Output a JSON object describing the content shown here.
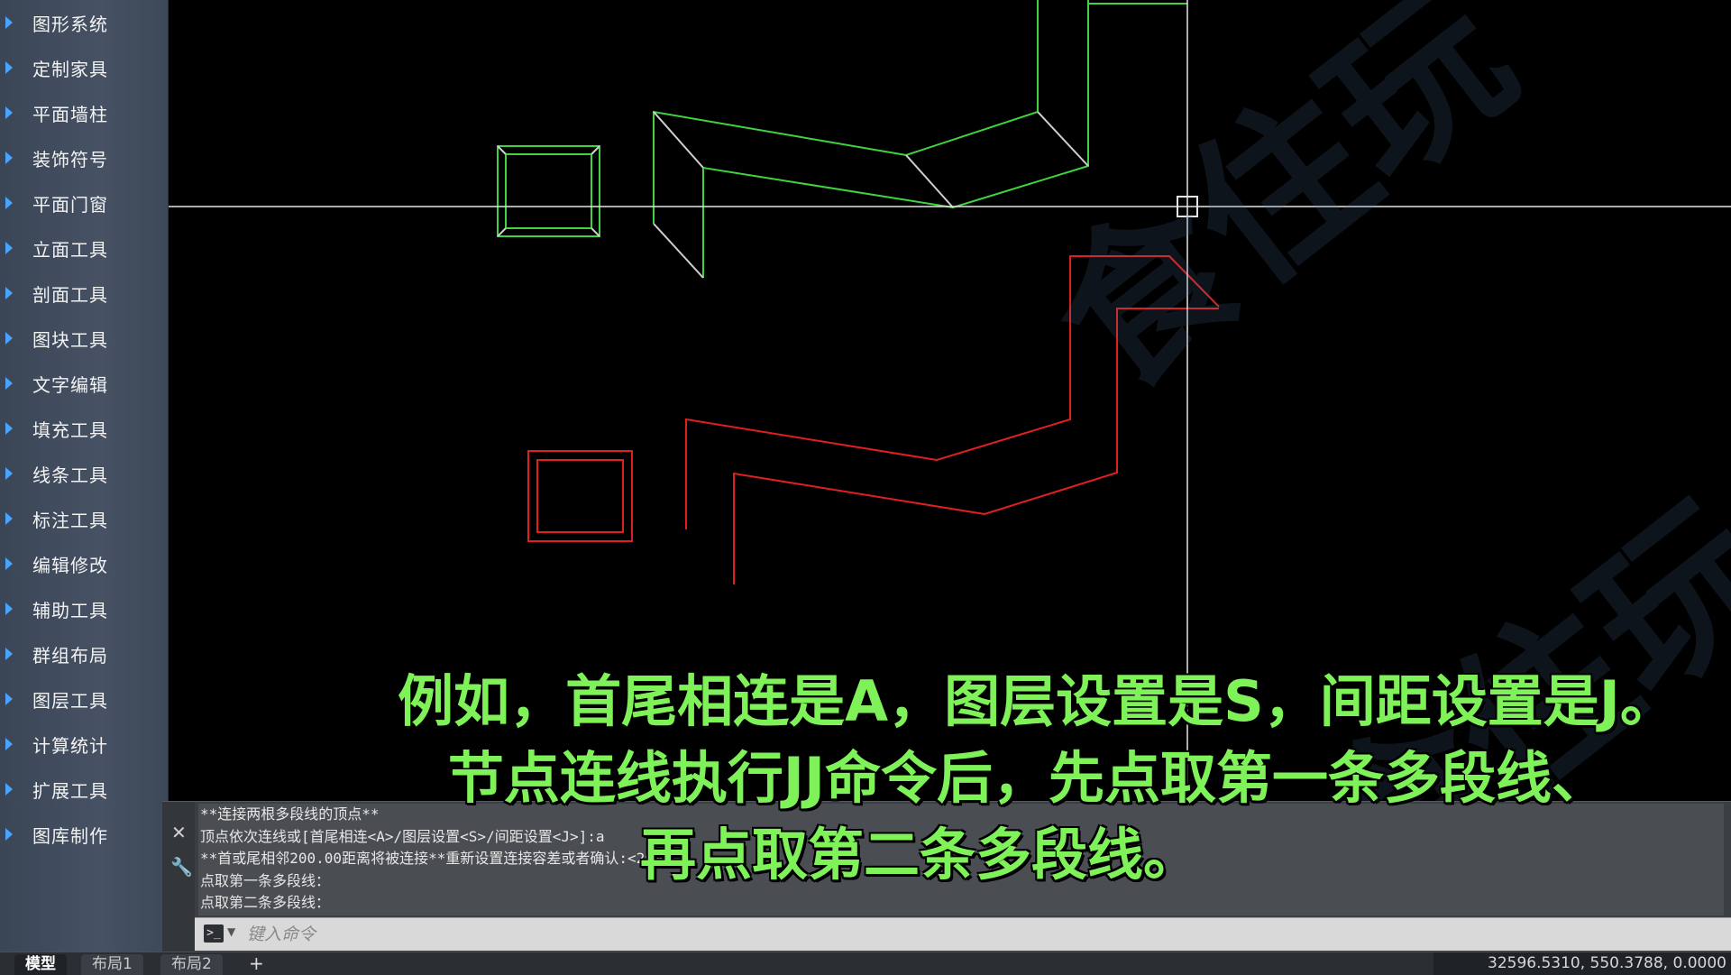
{
  "sidebar": {
    "items": [
      {
        "label": "图形系统"
      },
      {
        "label": "定制家具"
      },
      {
        "label": "平面墙柱"
      },
      {
        "label": "装饰符号"
      },
      {
        "label": "平面门窗"
      },
      {
        "label": "立面工具"
      },
      {
        "label": "剖面工具"
      },
      {
        "label": "图块工具"
      },
      {
        "label": "文字编辑"
      },
      {
        "label": "填充工具"
      },
      {
        "label": "线条工具"
      },
      {
        "label": "标注工具"
      },
      {
        "label": "编辑修改"
      },
      {
        "label": "辅助工具"
      },
      {
        "label": "群组布局"
      },
      {
        "label": "图层工具"
      },
      {
        "label": "计算统计"
      },
      {
        "label": "扩展工具"
      },
      {
        "label": "图库制作"
      }
    ]
  },
  "watermark": {
    "text": "食住玩"
  },
  "command": {
    "history": [
      "**连接两根多段线的顶点**",
      "顶点依次连线或[首尾相连<A>/图层设置<S>/间距设置<J>]:a",
      "**首或尾相邻200.00距离将被连接**重新设置连接容差或者确认:<200",
      "点取第一条多段线：",
      "点取第二条多段线："
    ],
    "input_placeholder": "键入命令",
    "prompt_icon": ">_"
  },
  "subtitle": {
    "line1": "例如，首尾相连是A，图层设置是S，间距设置是J。",
    "line2": "节点连线执行JJ命令后，先点取第一条多段线、",
    "line3": "再点取第二条多段线。"
  },
  "tabs": {
    "model": "模型",
    "layout1": "布局1",
    "layout2": "布局2",
    "add": "+"
  },
  "status": {
    "coordinates": "32596.5310, 550.3788, 0.0000"
  },
  "colors": {
    "green_lines": "#3fd43f",
    "red_lines": "#e02020",
    "crosshair": "#e6e6e6",
    "subtitle": "#7ff25a"
  }
}
